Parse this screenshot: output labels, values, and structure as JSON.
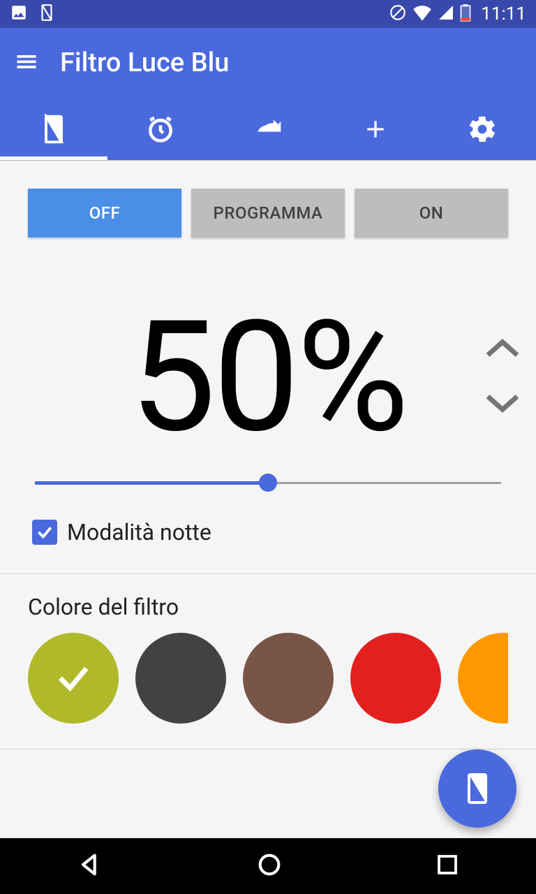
{
  "status": {
    "time": "11:11"
  },
  "app": {
    "title": "Filtro Luce Blu"
  },
  "modes": {
    "off": "OFF",
    "program": "PROGRAMMA",
    "on": "ON"
  },
  "intensity": {
    "value": "50%",
    "slider_percent": 50
  },
  "night_mode": {
    "label": "Modalità notte",
    "checked": true
  },
  "filter_color": {
    "title": "Colore del filtro",
    "options": [
      {
        "color": "#b0b92a",
        "selected": true
      },
      {
        "color": "#424242",
        "selected": false
      },
      {
        "color": "#795548",
        "selected": false
      },
      {
        "color": "#e4201f",
        "selected": false
      },
      {
        "color": "#ff9800",
        "selected": false
      }
    ]
  }
}
